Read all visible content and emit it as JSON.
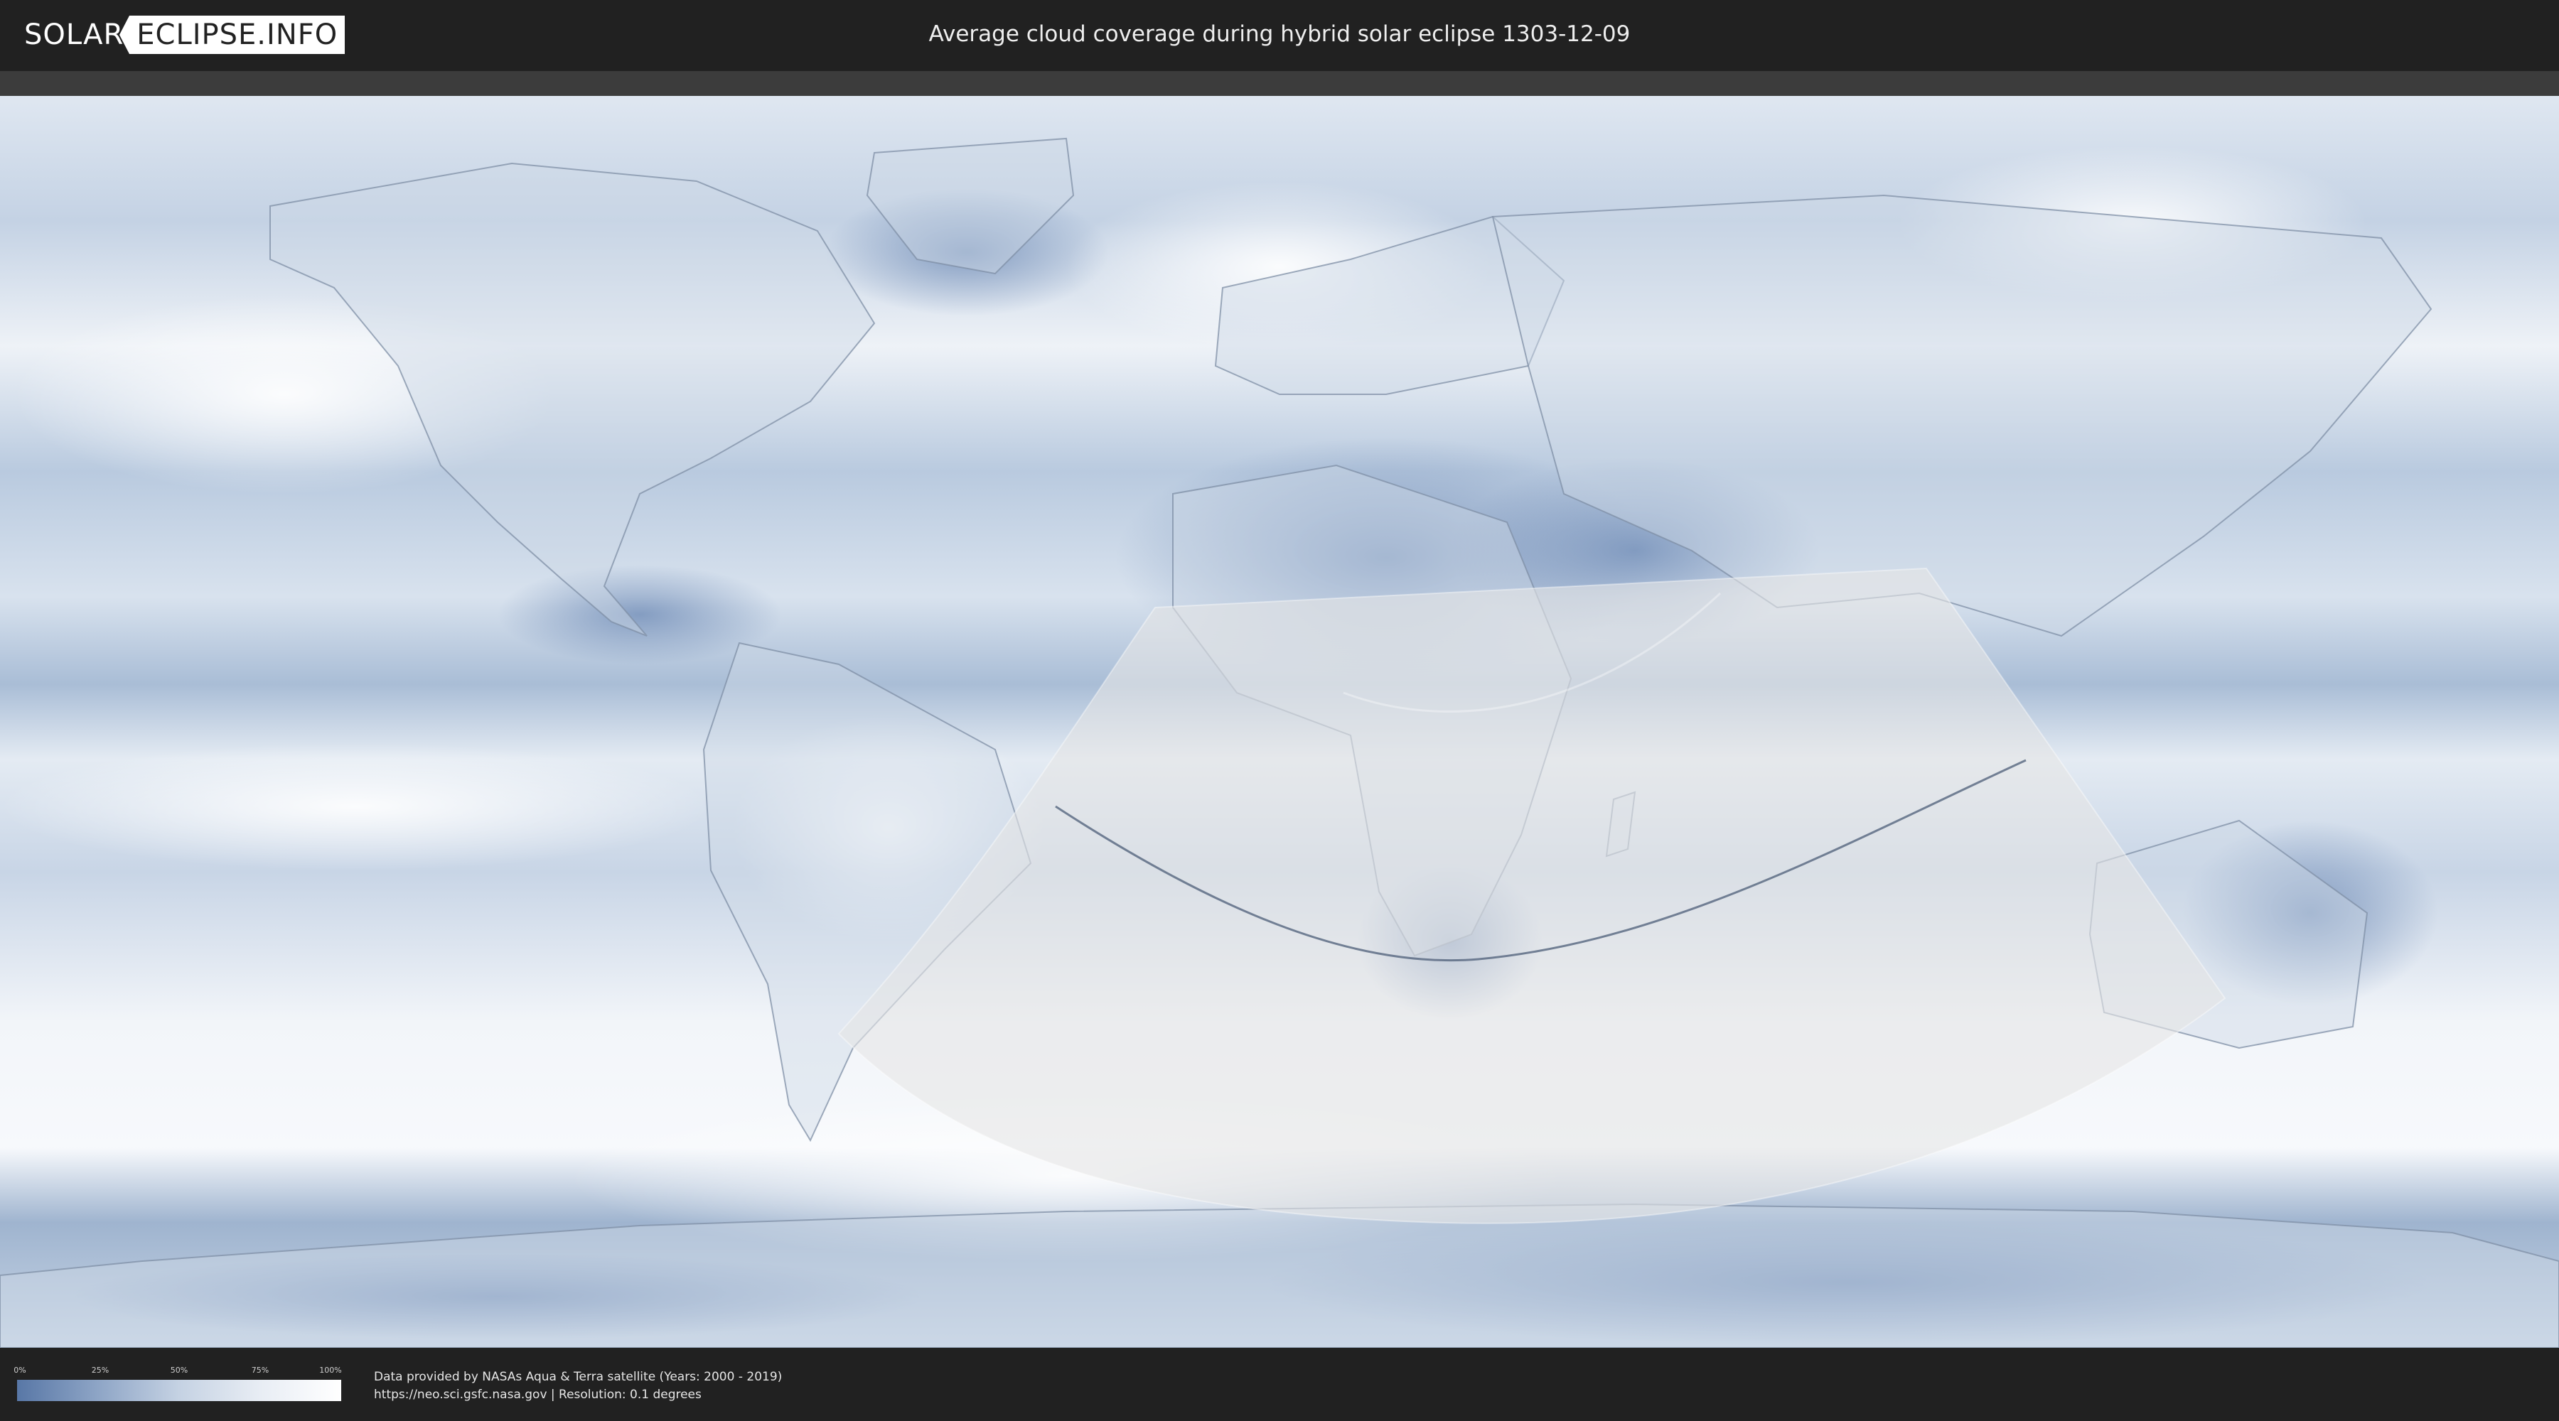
{
  "header": {
    "logo_left": "SOLAR",
    "logo_right": "ECLIPSE.INFO",
    "title": "Average cloud coverage during hybrid solar eclipse 1303-12-09"
  },
  "legend": {
    "ticks": [
      "0%",
      "25%",
      "50%",
      "75%",
      "100%"
    ],
    "colors": [
      "#5877a6",
      "#8ea5c6",
      "#c5d2e3",
      "#e8edf4",
      "#ffffff"
    ]
  },
  "footer": {
    "credit_line1": "Data provided by NASAs Aqua & Terra satellite (Years: 2000 - 2019)",
    "credit_line2": "https://neo.sci.gsfc.nasa.gov | Resolution: 0.1 degrees"
  },
  "colors": {
    "background": "#212121",
    "cloud_clear": "#5877a6",
    "cloud_full": "#ffffff",
    "eclipse_overlay": "#e8e8e8"
  }
}
